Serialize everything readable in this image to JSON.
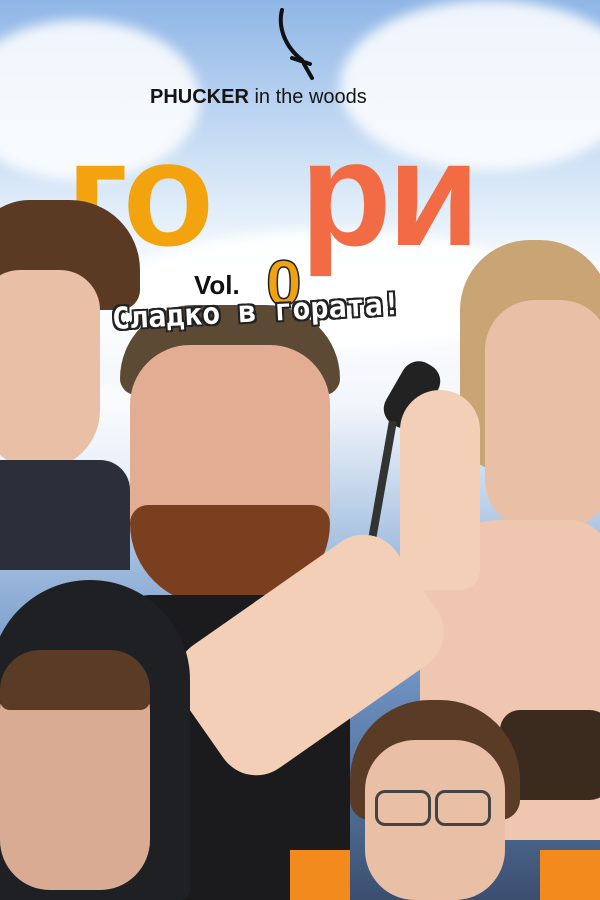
{
  "brand": {
    "prefix": "PHUCKER",
    "suffix": "in the woods"
  },
  "title": {
    "part1": "го",
    "part2": "ри"
  },
  "volume": {
    "label": "Vol.",
    "number": "0"
  },
  "tagline": "Сладко в гората!",
  "icons": {
    "top": "saber-icon"
  },
  "colors": {
    "title_primary": "#f2a30d",
    "title_secondary": "#f26b44"
  }
}
